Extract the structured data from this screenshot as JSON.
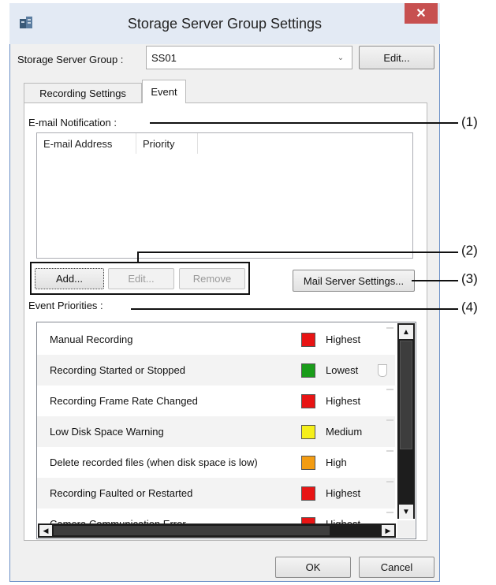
{
  "window": {
    "title": "Storage Server Group Settings",
    "close_glyph": "✕"
  },
  "group": {
    "label": "Storage Server Group :",
    "selected": "SS01",
    "edit_label": "Edit..."
  },
  "tabs": [
    {
      "label": "Recording Settings"
    },
    {
      "label": "Event"
    }
  ],
  "email": {
    "section_label": "E-mail Notification :",
    "columns": [
      "E-mail Address",
      "Priority"
    ],
    "buttons": {
      "add": "Add...",
      "edit": "Edit...",
      "remove": "Remove",
      "mail_server": "Mail Server Settings..."
    }
  },
  "priorities": {
    "section_label": "Event Priorities :",
    "rows": [
      {
        "event": "Manual Recording",
        "level": "Highest",
        "color": "#e81414"
      },
      {
        "event": "Recording Started or Stopped",
        "level": "Lowest",
        "color": "#1a9c1a"
      },
      {
        "event": "Recording Frame Rate Changed",
        "level": "Highest",
        "color": "#e81414"
      },
      {
        "event": "Low Disk Space Warning",
        "level": "Medium",
        "color": "#f5ef1a"
      },
      {
        "event": "Delete recorded files (when disk space is low)",
        "level": "High",
        "color": "#f39c12"
      },
      {
        "event": "Recording Faulted or Restarted",
        "level": "Highest",
        "color": "#e81414"
      },
      {
        "event": "Camera Communication Error",
        "level": "Highest",
        "color": "#e81414"
      }
    ]
  },
  "footer": {
    "ok": "OK",
    "cancel": "Cancel"
  },
  "callouts": [
    "(1)",
    "(2)",
    "(3)",
    "(4)"
  ]
}
